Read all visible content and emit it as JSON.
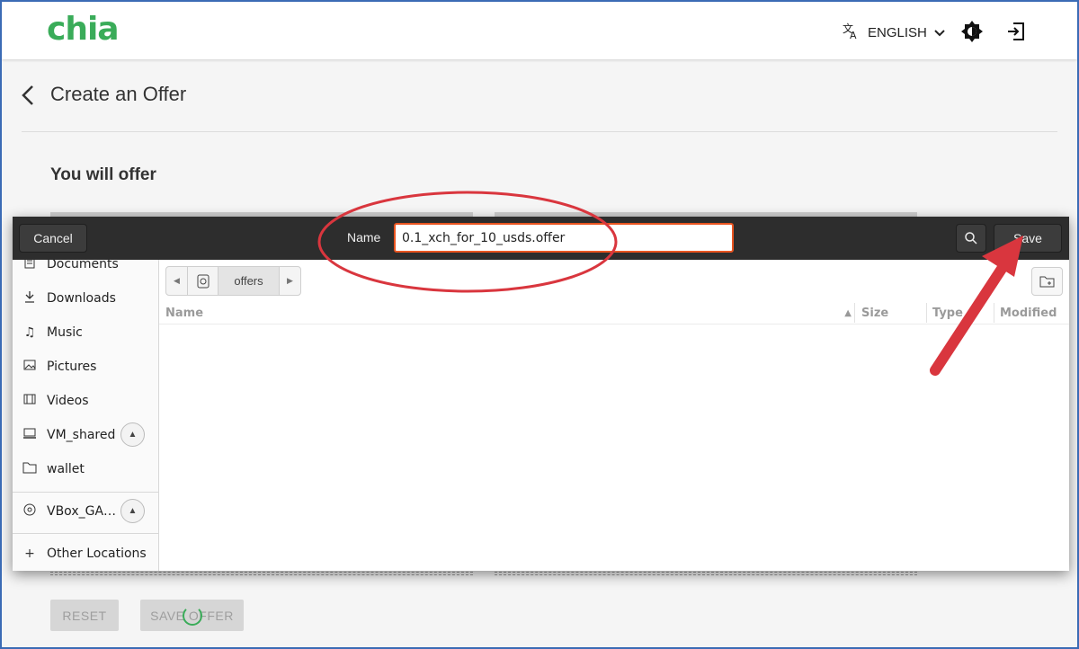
{
  "app": {
    "logo": "chia",
    "language": "ENGLISH",
    "icons": {
      "translate": "translate-icon",
      "chevron": "chevron-down-icon",
      "theme": "brightness-icon",
      "logout": "logout-icon"
    }
  },
  "page": {
    "title": "Create an Offer",
    "section": "You will offer",
    "reset_label": "RESET",
    "save_offer_label": "SAVE OFFER"
  },
  "dialog": {
    "cancel_label": "Cancel",
    "name_label": "Name",
    "filename": "0.1_xch_for_10_usds.offer",
    "save_label": "Save",
    "path": [
      "offers"
    ],
    "columns": [
      "Name",
      "Size",
      "Type",
      "Modified"
    ],
    "sidebar": [
      {
        "label": "Documents",
        "icon": "document-icon"
      },
      {
        "label": "Downloads",
        "icon": "download-icon"
      },
      {
        "label": "Music",
        "icon": "music-icon"
      },
      {
        "label": "Pictures",
        "icon": "picture-icon"
      },
      {
        "label": "Videos",
        "icon": "video-icon"
      },
      {
        "label": "VM_shared",
        "icon": "drive-icon"
      },
      {
        "label": "wallet",
        "icon": "folder-icon"
      },
      {
        "label": "VBox_GA…",
        "icon": "disc-icon"
      },
      {
        "label": "Other Locations",
        "icon": "plus-icon"
      }
    ]
  },
  "colors": {
    "brand": "#3aac59",
    "headerbar": "#2d2d2d",
    "focus": "#e95420",
    "annotation": "#d9363e"
  }
}
